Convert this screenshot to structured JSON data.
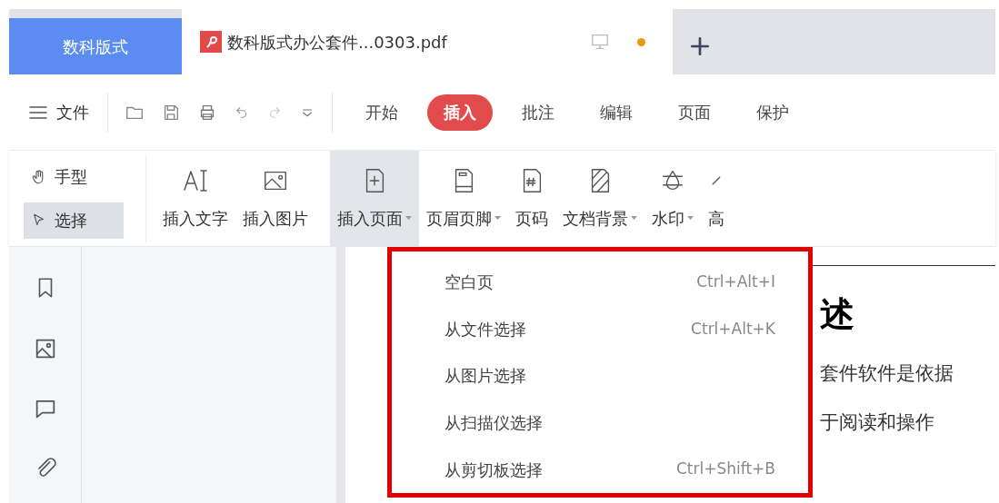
{
  "app_tab": {
    "label": "数科版式"
  },
  "doc_tab": {
    "title": "数科版式办公套件...0303.pdf",
    "unsaved": true
  },
  "file_menu": {
    "label": "文件"
  },
  "menu_tabs": [
    {
      "label": "开始",
      "selected": false
    },
    {
      "label": "插入",
      "selected": true
    },
    {
      "label": "批注",
      "selected": false
    },
    {
      "label": "编辑",
      "selected": false
    },
    {
      "label": "页面",
      "selected": false
    },
    {
      "label": "保护",
      "selected": false
    }
  ],
  "modes": [
    {
      "label": "手型",
      "selected": false
    },
    {
      "label": "选择",
      "selected": true
    }
  ],
  "ribbon": [
    {
      "label": "插入文字",
      "dropdown": false,
      "selected": false
    },
    {
      "label": "插入图片",
      "dropdown": false,
      "selected": false
    },
    {
      "label": "插入页面",
      "dropdown": true,
      "selected": true
    },
    {
      "label": "页眉页脚",
      "dropdown": true,
      "selected": false
    },
    {
      "label": "页码",
      "dropdown": false,
      "selected": false
    },
    {
      "label": "文档背景",
      "dropdown": true,
      "selected": false
    },
    {
      "label": "水印",
      "dropdown": true,
      "selected": false
    },
    {
      "label": "高",
      "dropdown": false,
      "selected": false
    }
  ],
  "dropdown": {
    "items": [
      {
        "label": "空白页",
        "shortcut": "Ctrl+Alt+I"
      },
      {
        "label": "从文件选择",
        "shortcut": "Ctrl+Alt+K"
      },
      {
        "label": "从图片选择"
      },
      {
        "label": "从扫描仪选择"
      },
      {
        "label": "从剪切板选择",
        "shortcut": "Ctrl+Shift+B"
      }
    ]
  },
  "document": {
    "heading": "述",
    "lines": [
      "套件软件是依据",
      "于阅读和操作"
    ]
  }
}
